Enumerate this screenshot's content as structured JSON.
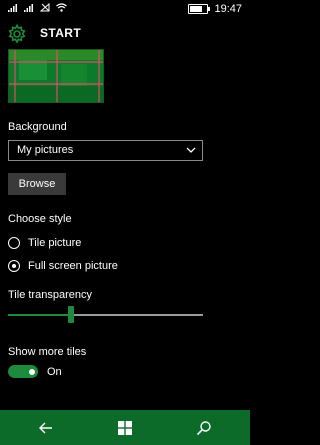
{
  "status_bar": {
    "time": "19:47",
    "icons": [
      "signal-icon",
      "signal-icon",
      "wifi-icon",
      "battery-icon"
    ]
  },
  "header": {
    "title": "START",
    "icon": "gear-icon"
  },
  "background": {
    "label": "Background",
    "dropdown_value": "My pictures",
    "browse_label": "Browse"
  },
  "style": {
    "label": "Choose style",
    "options": [
      {
        "label": "Tile picture",
        "selected": false
      },
      {
        "label": "Full screen picture",
        "selected": true
      }
    ]
  },
  "transparency": {
    "label": "Tile transparency",
    "value": 0.32
  },
  "more_tiles": {
    "label": "Show more tiles",
    "state_label": "On",
    "enabled": true
  },
  "navbar": {
    "icons": [
      "back-icon",
      "windows-start-icon",
      "search-icon"
    ]
  },
  "colors": {
    "accent": "#1e8a3c",
    "navbar": "#0d6b2a",
    "background": "#000000"
  }
}
